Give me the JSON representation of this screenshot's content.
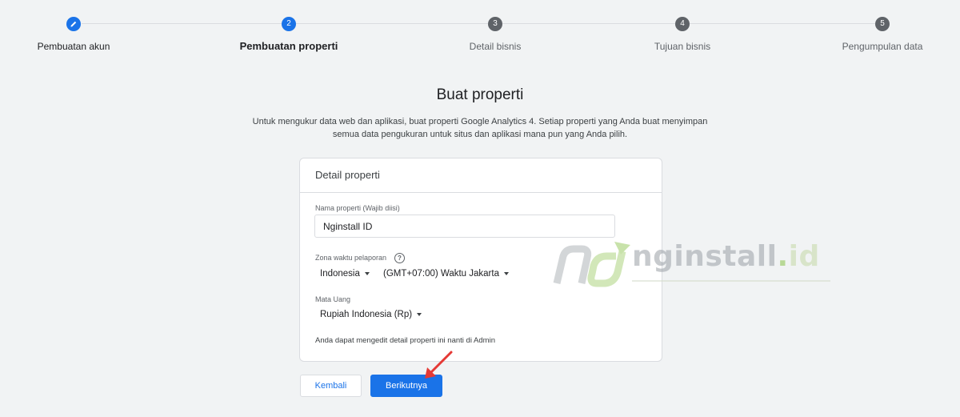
{
  "stepper": {
    "steps": [
      {
        "label": "Pembuatan akun",
        "number": "",
        "state": "done"
      },
      {
        "label": "Pembuatan properti",
        "number": "2",
        "state": "active"
      },
      {
        "label": "Detail bisnis",
        "number": "3",
        "state": "todo"
      },
      {
        "label": "Tujuan bisnis",
        "number": "4",
        "state": "todo"
      },
      {
        "label": "Pengumpulan data",
        "number": "5",
        "state": "todo"
      }
    ]
  },
  "page": {
    "title": "Buat properti",
    "description_line1": "Untuk mengukur data web dan aplikasi, buat properti Google Analytics 4. Setiap properti yang Anda buat menyimpan",
    "description_line2": "semua data pengukuran untuk situs dan aplikasi mana pun yang Anda pilih."
  },
  "card": {
    "title": "Detail properti",
    "property_name": {
      "label": "Nama properti (Wajib diisi)",
      "value": "Nginstall ID"
    },
    "timezone": {
      "label": "Zona waktu pelaporan",
      "country": "Indonesia",
      "zone": "(GMT+07:00) Waktu Jakarta"
    },
    "currency": {
      "label": "Mata Uang",
      "value": "Rupiah Indonesia (Rp)"
    },
    "hint": "Anda dapat mengedit detail properti ini nanti di Admin"
  },
  "buttons": {
    "back": "Kembali",
    "next": "Berikutnya"
  },
  "watermark": {
    "text_main": "nginstall",
    "text_dot": ".",
    "text_id": "id"
  },
  "colors": {
    "accent": "#1a73e8",
    "arrow": "#e53935"
  }
}
